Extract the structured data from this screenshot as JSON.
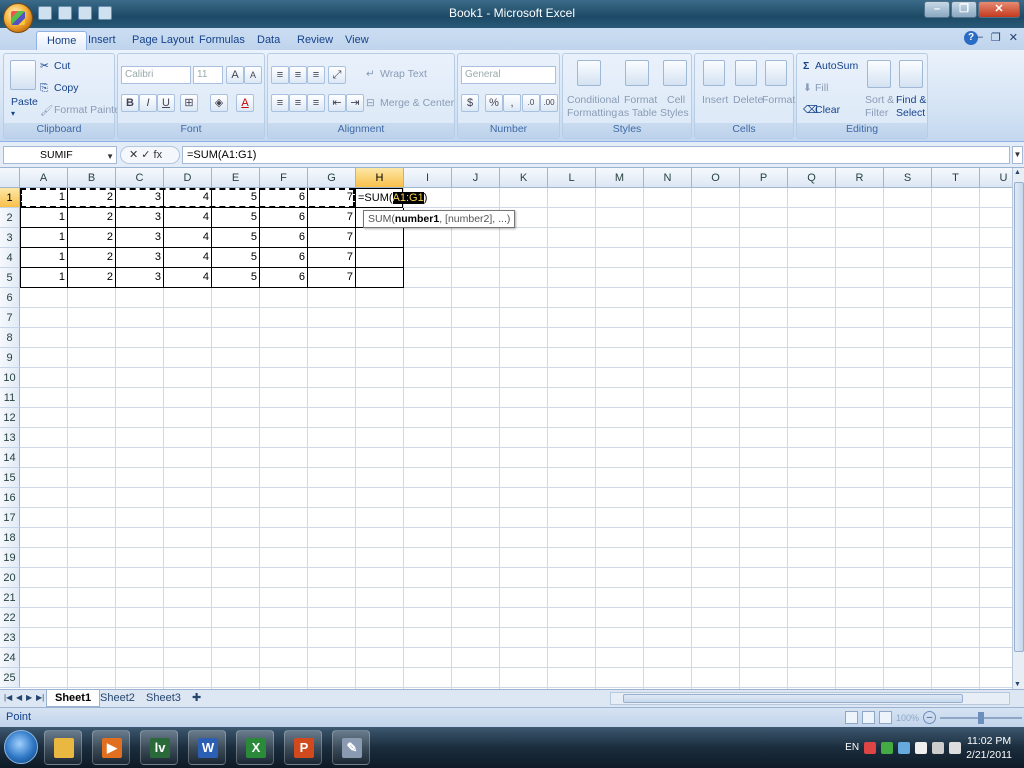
{
  "window": {
    "title": "Book1 - Microsoft Excel"
  },
  "tabs": [
    "Home",
    "Insert",
    "Page Layout",
    "Formulas",
    "Data",
    "Review",
    "View"
  ],
  "ribbon": {
    "clipboard": {
      "label": "Clipboard",
      "paste": "Paste",
      "cut": "Cut",
      "copy": "Copy",
      "format_painter": "Format Painter"
    },
    "font": {
      "label": "Font",
      "font_name": "Calibri",
      "font_size": "11",
      "bold": "B",
      "italic": "I",
      "underline": "U"
    },
    "alignment": {
      "label": "Alignment",
      "wrap_text": "Wrap Text",
      "merge_center": "Merge & Center"
    },
    "number": {
      "label": "Number",
      "format": "General",
      "currency": "$",
      "percent": "%",
      "comma": ","
    },
    "styles": {
      "label": "Styles",
      "conditional_1": "Conditional",
      "conditional_2": "Formatting",
      "format_table_1": "Format",
      "format_table_2": "as Table",
      "cell_styles_1": "Cell",
      "cell_styles_2": "Styles"
    },
    "cells": {
      "label": "Cells",
      "insert": "Insert",
      "delete": "Delete",
      "format": "Format"
    },
    "editing": {
      "label": "Editing",
      "autosum": "AutoSum",
      "fill": "Fill",
      "clear": "Clear",
      "sort_1": "Sort &",
      "sort_2": "Filter",
      "find_1": "Find &",
      "find_2": "Select"
    }
  },
  "formula_bar": {
    "name_box": "SUMIF",
    "tools": "✕ ✓ fx",
    "formula": "=SUM(A1:G1)"
  },
  "sheet": {
    "columns": [
      "A",
      "B",
      "C",
      "D",
      "E",
      "F",
      "G",
      "H",
      "I",
      "J",
      "K",
      "L",
      "M",
      "N",
      "O",
      "P",
      "Q",
      "R",
      "S",
      "T",
      "U"
    ],
    "rows": [
      "1",
      "2",
      "3",
      "4",
      "5",
      "6",
      "7",
      "8",
      "9",
      "10",
      "11",
      "12",
      "13",
      "14",
      "15",
      "16",
      "17",
      "18",
      "19",
      "20",
      "21",
      "22",
      "23",
      "24",
      "25"
    ],
    "data": [
      [
        "1",
        "2",
        "3",
        "4",
        "5",
        "6",
        "7"
      ],
      [
        "1",
        "2",
        "3",
        "4",
        "5",
        "6",
        "7"
      ],
      [
        "1",
        "2",
        "3",
        "4",
        "5",
        "6",
        "7"
      ],
      [
        "1",
        "2",
        "3",
        "4",
        "5",
        "6",
        "7"
      ],
      [
        "1",
        "2",
        "3",
        "4",
        "5",
        "6",
        "7"
      ]
    ],
    "active_cell_prefix": "=SUM(",
    "active_cell_range": "A1:G1",
    "active_cell_suffix": ")",
    "tooltip_prefix": "SUM(",
    "tooltip_arg": "number1",
    "tooltip_rest": ", [number2], ...)"
  },
  "sheet_tabs": [
    "Sheet1",
    "Sheet2",
    "Sheet3"
  ],
  "status": {
    "mode": "Point",
    "zoom": "100%"
  },
  "taskbar": {
    "language": "EN",
    "time": "11:02 PM",
    "date": "2/21/2011"
  },
  "colors": {
    "accent": "#15428b",
    "selected_header": "#f8c04a",
    "ribbon_bg": "#d2e2f4"
  }
}
